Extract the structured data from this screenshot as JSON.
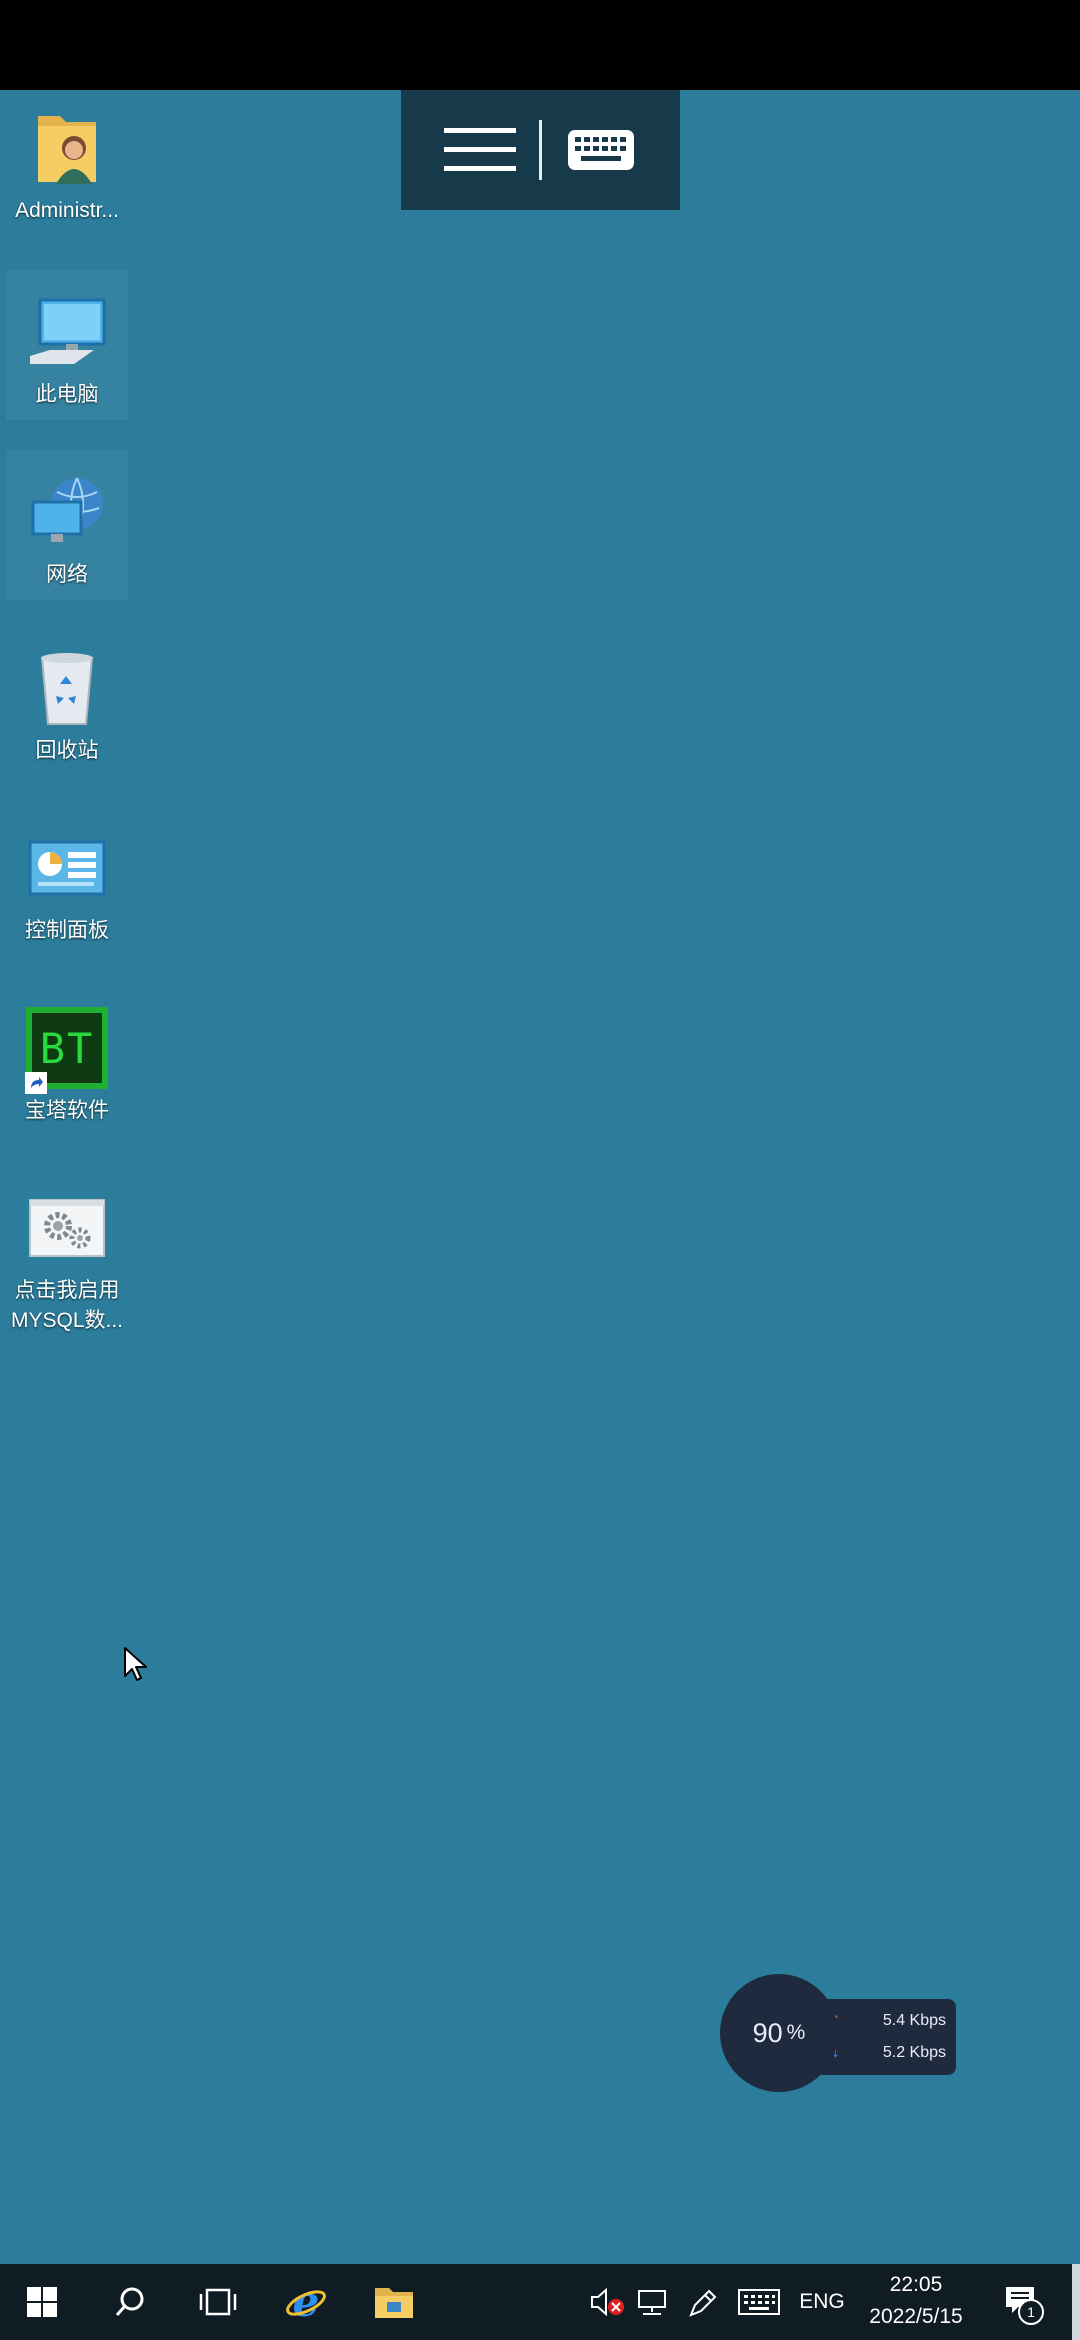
{
  "toolbar": {
    "menu_icon": "hamburger-menu-icon",
    "keyboard_icon": "keyboard-icon"
  },
  "desktop": {
    "icons": [
      {
        "name": "user-folder",
        "label": "Administr...",
        "icon": "user-folder-icon"
      },
      {
        "name": "this-pc",
        "label": "此电脑",
        "icon": "computer-icon"
      },
      {
        "name": "network",
        "label": "网络",
        "icon": "network-icon"
      },
      {
        "name": "recycle-bin",
        "label": "回收站",
        "icon": "recycle-bin-icon"
      },
      {
        "name": "control-panel",
        "label": "控制面板",
        "icon": "control-panel-icon"
      },
      {
        "name": "bt-panel",
        "label": "宝塔软件",
        "icon": "bt-panel-icon",
        "logo_text": "BT"
      },
      {
        "name": "mysql-start",
        "label_line1": "点击我启用",
        "label_line2": "MYSQL数...",
        "icon": "gears-icon"
      }
    ]
  },
  "net_widget": {
    "percent": "90",
    "percent_unit": "%",
    "upload": "5.4 Kbps",
    "download": "5.2 Kbps",
    "upload_color": "#f0962c",
    "download_color": "#2f8ff0"
  },
  "taskbar": {
    "items": [
      "start-button",
      "search-icon",
      "task-view-icon",
      "internet-explorer-icon",
      "file-explorer-icon"
    ],
    "tray": {
      "volume_icon": "volume-muted-icon",
      "network_icon": "network-status-icon",
      "pen_icon": "pen-icon",
      "keyboard_icon": "touch-keyboard-icon",
      "language": "ENG",
      "time": "22:05",
      "date": "2022/5/15",
      "notifications_count": "1"
    }
  },
  "colors": {
    "desktop_bg": "#2b7d9b",
    "taskbar_bg": "#101c24",
    "toolbar_bg": "#163a4a"
  }
}
